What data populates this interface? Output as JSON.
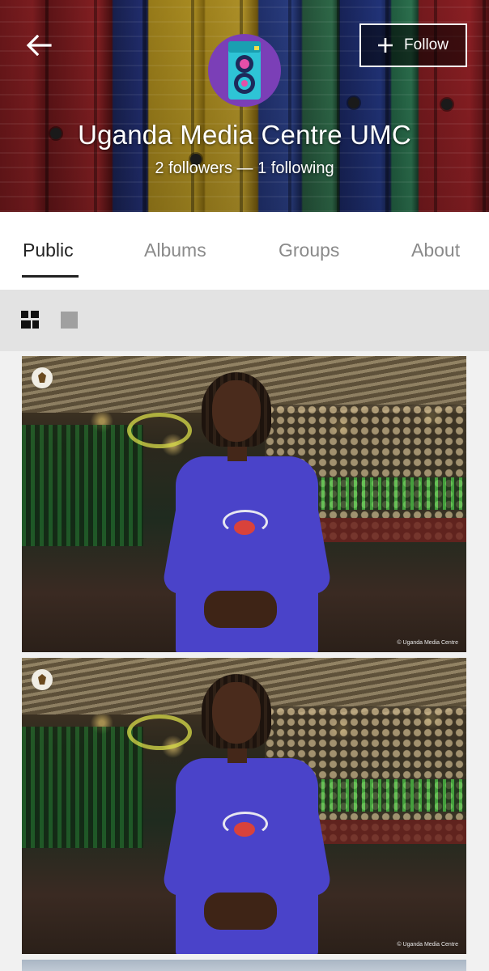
{
  "header": {
    "back_icon": "arrow-left-icon",
    "follow_label": "Follow",
    "follow_icon": "plus-icon",
    "avatar_icon": "camera-icon",
    "name": "Uganda Media Centre UMC",
    "stats": "2 followers — 1 following"
  },
  "tabs": [
    {
      "label": "Public",
      "active": true
    },
    {
      "label": "Albums",
      "active": false
    },
    {
      "label": "Groups",
      "active": false
    },
    {
      "label": "About",
      "active": false
    }
  ],
  "view_toggle": {
    "grid_icon": "grid-view-icon",
    "single_icon": "single-view-icon",
    "selected": "grid"
  },
  "photos": [
    {
      "credit": "© Uganda Media Centre"
    },
    {
      "credit": "© Uganda Media Centre"
    }
  ],
  "colors": {
    "avatar_bg": "#7b3fb7",
    "tab_active": "#222222",
    "tab_inactive": "#8a8a8a",
    "shirt": "#4a43c9"
  }
}
